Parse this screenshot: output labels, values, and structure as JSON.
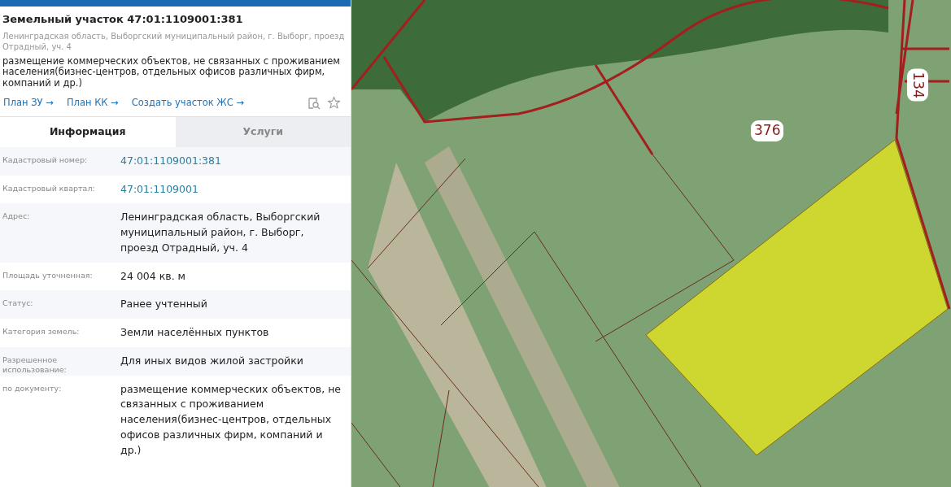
{
  "header": {
    "title": "Земельный участок 47:01:1109001:381",
    "address": "Ленинградская область, Выборгский муниципальный район, г. Выборг, проезд Отрадный, уч. 4",
    "purpose": "размещение коммерческих объектов, не связанных с проживанием населения(бизнес-центров, отдельных офисов различных фирм, компаний и др.)",
    "links": [
      "План ЗУ →",
      "План КК →",
      "Создать участок ЖС →"
    ]
  },
  "tabs": [
    {
      "label": "Информация",
      "selected": true
    },
    {
      "label": "Услуги",
      "selected": false
    }
  ],
  "fields": [
    {
      "label": "Кадастровый номер:",
      "value": "47:01:1109001:381",
      "kind": "link"
    },
    {
      "label": "Кадастровый квартал:",
      "value": "47:01:1109001",
      "kind": "link"
    },
    {
      "label": "Адрес:",
      "value": "Ленинградская область, Выборгский муниципальный район, г. Выборг, проезд Отрадный, уч. 4",
      "kind": "text"
    },
    {
      "label": "Площадь уточненная:",
      "value": "24 004 кв. м",
      "kind": "text"
    },
    {
      "label": "Статус:",
      "value": "Ранее учтенный",
      "kind": "text"
    },
    {
      "label": "Категория земель:",
      "value": "Земли населённых пунктов",
      "kind": "text"
    },
    {
      "label": "Разрешенное использование:",
      "value": "Для иных видов жилой застройки",
      "kind": "text"
    },
    {
      "label": "по документу:",
      "value": "размещение коммерческих объектов, не связанных с проживанием населения(бизнес-центров, отдельных офисов различных фирм, компаний и др.)",
      "kind": "text"
    }
  ],
  "map": {
    "labels": [
      {
        "text": "376",
        "rotated": false
      },
      {
        "text": "134",
        "rotated": true
      }
    ]
  }
}
